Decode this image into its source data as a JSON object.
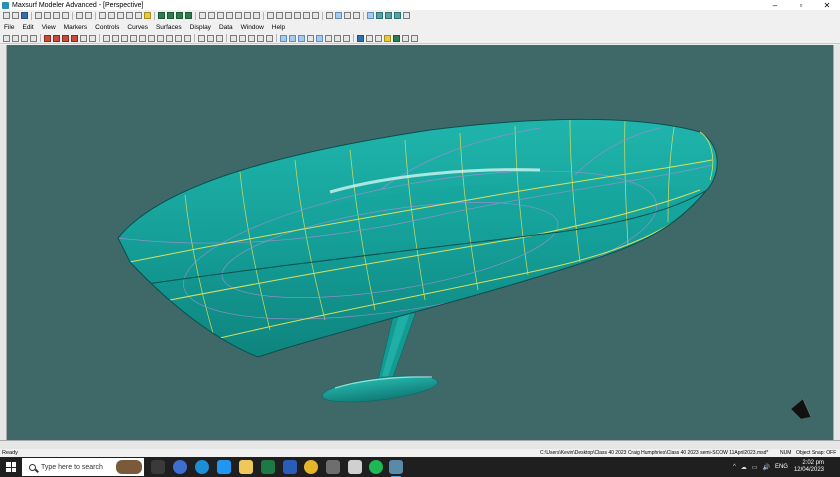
{
  "window": {
    "title": "Maxsurf Modeler Advanced - [Perspective]"
  },
  "window_controls": {
    "minimize": "–",
    "maximize": "▫",
    "close": "✕"
  },
  "menu": {
    "items": [
      "File",
      "Edit",
      "View",
      "Markers",
      "Controls",
      "Curves",
      "Surfaces",
      "Display",
      "Data",
      "Window",
      "Help"
    ]
  },
  "status": {
    "left": "Ready",
    "path": "C:\\Users\\Kevin\\Desktop\\Class 40 2023 Craig Humphries\\Class 40 2023 semi-SCOW 11April2023.msd*",
    "num": "NUM",
    "snap": "Object Snap: OFF"
  },
  "taskbar": {
    "search_placeholder": "Type here to search",
    "language": "ENG",
    "time": "2:02 pm",
    "date": "12/04/2023",
    "tray_icons": [
      "^",
      "☁",
      "▭",
      "🔊"
    ]
  },
  "colors": {
    "viewport_bg": "#3f6969",
    "hull": "#17a8a0",
    "grid_yellow": "#d8e060",
    "grid_purple": "#9a8fd0"
  }
}
